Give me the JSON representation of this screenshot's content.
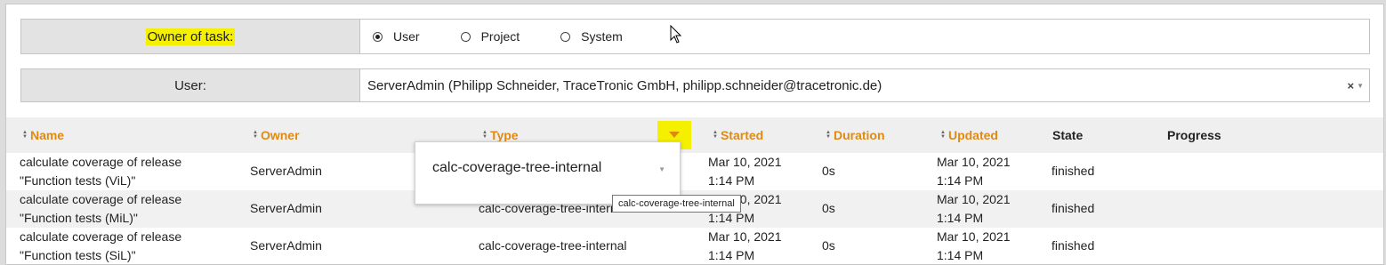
{
  "owner_row": {
    "label": "Owner of task:",
    "options": [
      "User",
      "Project",
      "System"
    ],
    "selected": "User"
  },
  "user_row": {
    "label": "User:",
    "value": "ServerAdmin (Philipp Schneider, TraceTronic GmbH, philipp.schneider@tracetronic.de)",
    "clear_symbol": "×",
    "caret_symbol": "▼"
  },
  "grid": {
    "columns": {
      "name": "Name",
      "owner": "Owner",
      "type": "Type",
      "started": "Started",
      "duration": "Duration",
      "updated": "Updated",
      "state": "State",
      "progress": "Progress"
    },
    "sort_symbol_up": "▲",
    "sort_symbol_down": "▼",
    "rows": [
      {
        "name_line1": "calculate coverage of release",
        "name_line2": "\"Function tests (ViL)\"",
        "owner": "ServerAdmin",
        "type": "calc-coverage-tree-internal",
        "started_date": "Mar 10, 2021",
        "started_time": "1:14 PM",
        "duration": "0s",
        "updated_date": "Mar 10, 2021",
        "updated_time": "1:14 PM",
        "state": "finished"
      },
      {
        "name_line1": "calculate coverage of release",
        "name_line2": "\"Function tests (MiL)\"",
        "owner": "ServerAdmin",
        "type": "calc-coverage-tree-internal",
        "started_date": "Mar 10, 2021",
        "started_time": "1:14 PM",
        "duration": "0s",
        "updated_date": "Mar 10, 2021",
        "updated_time": "1:14 PM",
        "state": "finished"
      },
      {
        "name_line1": "calculate coverage of release",
        "name_line2": "\"Function tests (SiL)\"",
        "owner": "ServerAdmin",
        "type": "calc-coverage-tree-internal",
        "started_date": "Mar 10, 2021",
        "started_time": "1:14 PM",
        "duration": "0s",
        "updated_date": "Mar 10, 2021",
        "updated_time": "1:14 PM",
        "state": "finished"
      }
    ]
  },
  "type_filter_popup": {
    "value": "calc-coverage-tree-internal",
    "caret_symbol": "▼"
  },
  "tooltip": {
    "text": "calc-coverage-tree-internal"
  },
  "colors": {
    "accent_orange": "#e08a12",
    "highlight_yellow": "#f4f000",
    "label_bg": "#e3e3e3"
  }
}
